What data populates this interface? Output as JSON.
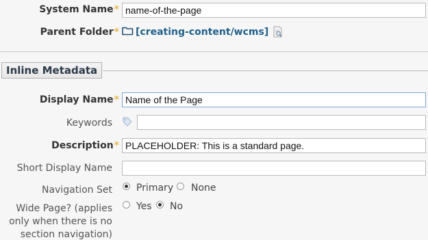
{
  "system_name": {
    "label": "System Name",
    "required_marker": "*",
    "value": "name-of-the-page"
  },
  "parent_folder": {
    "label": "Parent Folder",
    "required_marker": "*",
    "path": "[creating-content/wcms]",
    "folder_icon": "folder-icon",
    "browse_icon": "browse-page-icon"
  },
  "section": {
    "title": "Inline Metadata"
  },
  "display_name": {
    "label": "Display Name",
    "required_marker": "*",
    "value": "Name of the Page"
  },
  "keywords": {
    "label": "Keywords",
    "icon": "tag-icon",
    "value": ""
  },
  "description": {
    "label": "Description",
    "required_marker": "*",
    "value": "PLACEHOLDER: This is a standard page."
  },
  "short_display_name": {
    "label": "Short Display Name",
    "value": ""
  },
  "navigation_set": {
    "label": "Navigation Set",
    "options": [
      "Primary",
      "None"
    ],
    "selected": "Primary"
  },
  "wide_page": {
    "label": "Wide Page? (applies only when there is no section navigation)",
    "label_lines": [
      "Wide Page? (applies",
      "only when there is no",
      "section navigation)"
    ],
    "options": [
      "Yes",
      "No"
    ],
    "selected": "No"
  },
  "colors": {
    "required": "#e8b84a",
    "link": "#1f5f8b",
    "focus_border": "#7aa7d8"
  }
}
